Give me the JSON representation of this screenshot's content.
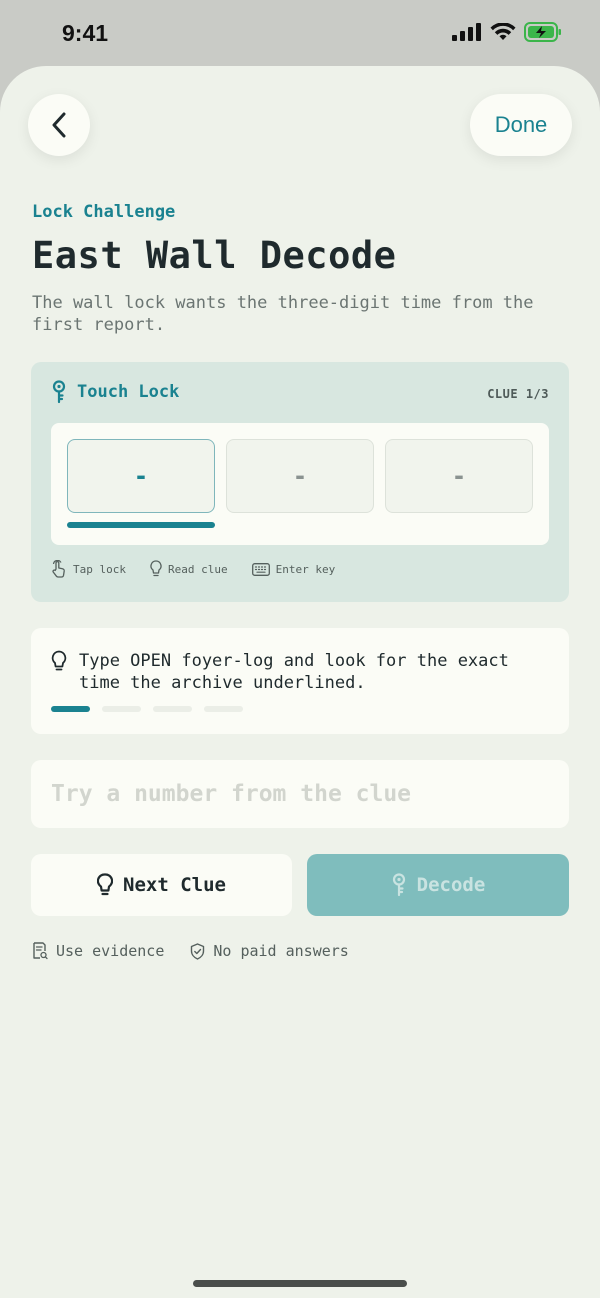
{
  "status_bar": {
    "time": "9:41"
  },
  "nav": {
    "done_label": "Done"
  },
  "header": {
    "eyebrow": "Lock Challenge",
    "title": "East Wall Decode",
    "subtitle": "The wall lock wants the three-digit time from the first report."
  },
  "lock": {
    "label": "Touch Lock",
    "clue_count": "CLUE 1/3",
    "digits": [
      "-",
      "-",
      "-"
    ],
    "hints": [
      "Tap lock",
      "Read clue",
      "Enter key"
    ]
  },
  "clue": {
    "text": "Type OPEN foyer-log and look for the exact time the archive underlined.",
    "progress_current": 1,
    "progress_total": 4
  },
  "answer": {
    "placeholder": "Try a number from the clue",
    "value": ""
  },
  "actions": {
    "next_clue": "Next Clue",
    "decode": "Decode"
  },
  "footer": {
    "evidence": "Use evidence",
    "no_paid": "No paid answers"
  },
  "colors": {
    "accent": "#1a8290",
    "background": "#eef2ea",
    "card": "#fbfcf6",
    "lock_card": "#d8e7e0",
    "decode_disabled": "#7fbdbd"
  }
}
